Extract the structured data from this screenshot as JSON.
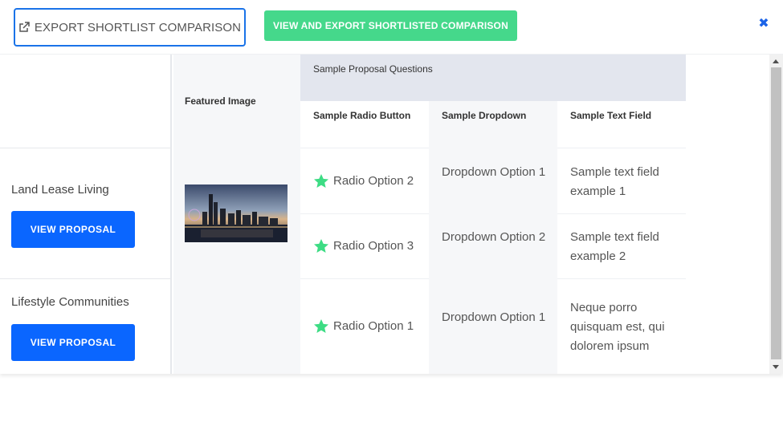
{
  "toolbar": {
    "export_label": "EXPORT SHORTLIST COMPARISON",
    "view_export_label": "VIEW AND EXPORT SHORTLISTED COMPARISON",
    "close_glyph": "✖",
    "export_icon": "external-link-icon",
    "accent_color": "#1a73e8",
    "green_color": "#45d88b"
  },
  "table": {
    "featured_image_header": "Featured Image",
    "group_header": "Sample Proposal Questions",
    "columns": [
      "Sample Radio Button",
      "Sample Dropdown",
      "Sample Text Field"
    ],
    "rows": [
      {
        "name": "Land Lease Living",
        "button": "VIEW PROPOSAL",
        "radio": "Radio Option 2",
        "dropdown": "Dropdown Option 1",
        "text": "Sample text field example 1"
      },
      {
        "name": "Lifestyle Communities",
        "button": "VIEW PROPOSAL",
        "radio": "Radio Option 3",
        "dropdown": "Dropdown Option 2",
        "text": "Sample text field example 2"
      },
      {
        "name": "",
        "button": "",
        "radio": "Radio Option 1",
        "dropdown": "Dropdown Option 1",
        "text": "Neque porro quisquam est, qui dolorem ipsum"
      }
    ],
    "star_icon": "star-icon",
    "star_color": "#3ddc84",
    "button_color": "#0a66ff"
  }
}
